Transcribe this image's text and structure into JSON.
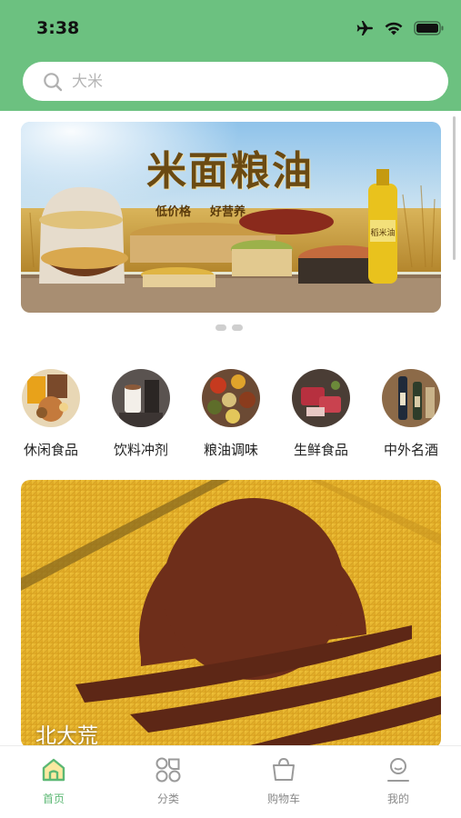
{
  "status_bar": {
    "time": "3:38"
  },
  "search": {
    "placeholder": "大米"
  },
  "banner": {
    "title": "米面粮油",
    "tags": [
      "低价格",
      "好营养"
    ],
    "product_label": "稻米油",
    "pagination": {
      "count": 2
    }
  },
  "categories": [
    {
      "label": "休闲食品"
    },
    {
      "label": "饮料冲剂"
    },
    {
      "label": "粮油调味"
    },
    {
      "label": "生鲜食品"
    },
    {
      "label": "中外名酒"
    }
  ],
  "brand_card": {
    "name": "北大荒"
  },
  "tabbar": {
    "items": [
      {
        "label": "首页",
        "active": true
      },
      {
        "label": "分类",
        "active": false
      },
      {
        "label": "购物车",
        "active": false
      },
      {
        "label": "我的",
        "active": false
      }
    ]
  },
  "colors": {
    "header_green": "#6cc180",
    "active_green": "#5cb874",
    "inactive_gray": "#8a8a8a"
  }
}
